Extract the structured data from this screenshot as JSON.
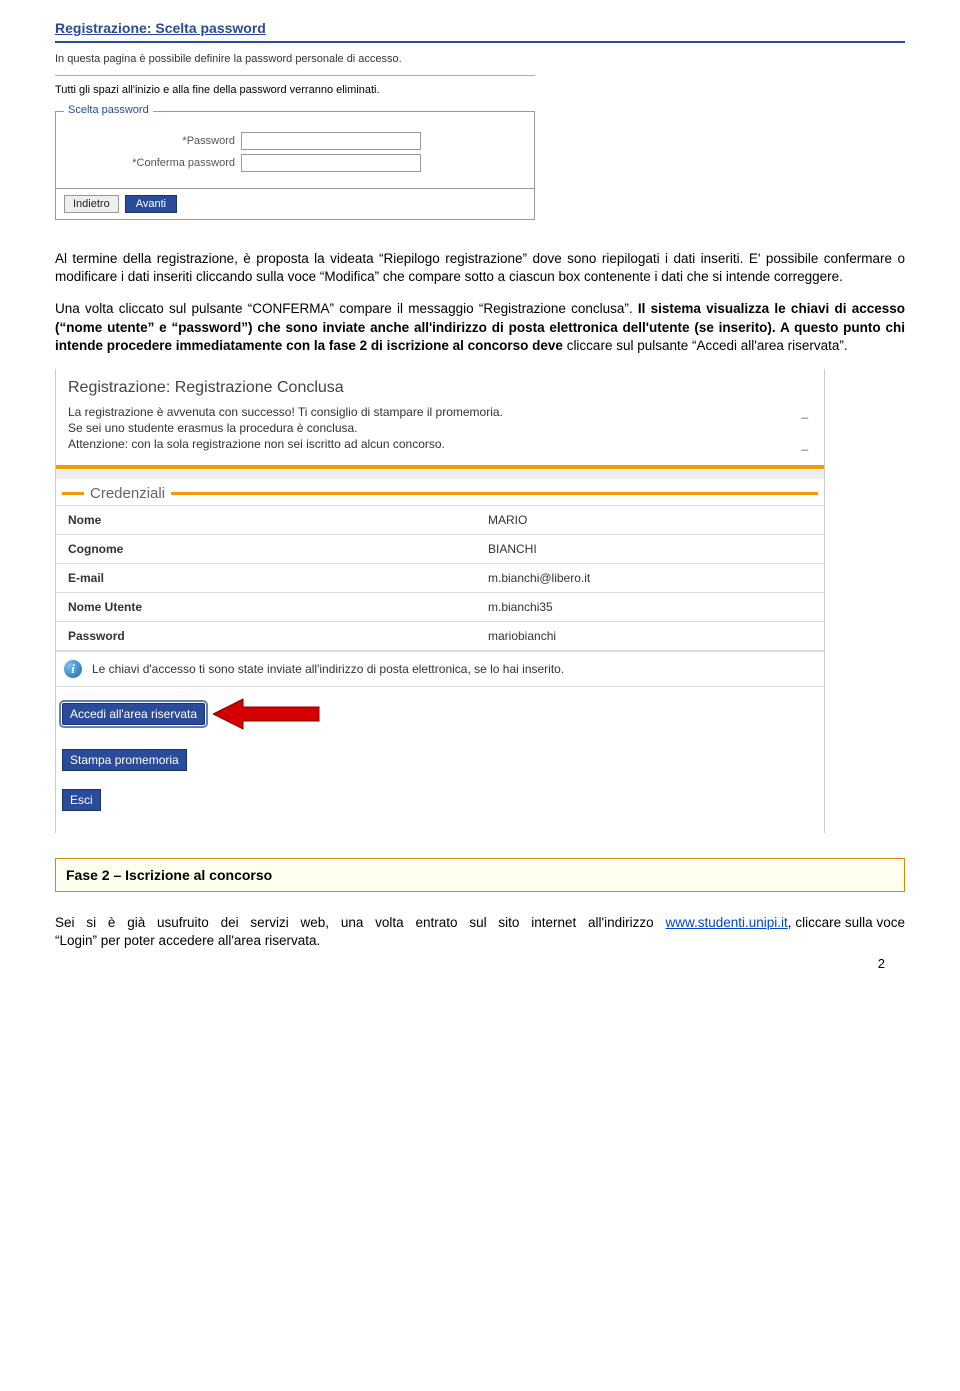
{
  "sec1": {
    "title": "Registrazione: Scelta password",
    "sub": "In questa pagina è possibile definire la password personale di accesso.",
    "note": "Tutti gli spazi all'inizio e alla fine della password verranno eliminati.",
    "legend": "Scelta password",
    "pw_label": "*Password",
    "pw2_label": "*Conferma password",
    "back": "Indietro",
    "next": "Avanti"
  },
  "para1": "Al termine della registrazione, è proposta la videata “Riepilogo registrazione” dove sono riepilogati i dati inseriti. E' possibile confermare o modificare i dati inseriti cliccando sulla voce “Modifica” che compare sotto a ciascun box contenente i dati che si intende correggere.",
  "para2_pre": "Una volta cliccato sul pulsante “CONFERMA” compare il messaggio “Registrazione conclusa”. ",
  "para2_bold": "Il sistema visualizza le chiavi di accesso (“nome utente” e “password”) che sono inviate anche all'indirizzo di posta elettronica dell'utente (se inserito). A questo punto chi intende procedere immediatamente con la fase 2 di iscrizione al concorso deve ",
  "para2_post": "cliccare sul pulsante “Accedi all'area riservata”.",
  "sec2": {
    "title": "Registrazione: Registrazione Conclusa",
    "desc": [
      "La registrazione è avvenuta con successo! Ti consiglio di stampare il promemoria.",
      "Se sei uno studente erasmus la procedura è conclusa.",
      "Attenzione: con la sola registrazione non sei iscritto ad alcun concorso."
    ],
    "legend": "Credenziali",
    "rows": [
      {
        "k": "Nome",
        "v": "MARIO"
      },
      {
        "k": "Cognome",
        "v": "BIANCHI"
      },
      {
        "k": "E-mail",
        "v": "m.bianchi@libero.it"
      },
      {
        "k": "Nome Utente",
        "v": "m.bianchi35"
      },
      {
        "k": "Password",
        "v": "mariobianchi"
      }
    ],
    "info": "Le chiavi d'accesso ti sono state inviate all'indirizzo di posta elettronica, se lo hai inserito.",
    "btn_accedi": "Accedi all'area riservata",
    "btn_stampa": "Stampa promemoria",
    "btn_esci": "Esci"
  },
  "fase_box": "Fase 2 – Iscrizione al concorso",
  "para3_pre": "Sei si è già usufruito dei servizi web, una volta entrato sul sito internet all'indirizzo ",
  "para3_link": "www.studenti.unipi.it",
  "para3_post": ", cliccare sulla voce “Login” per poter accedere all'area riservata.",
  "page_num": "2"
}
